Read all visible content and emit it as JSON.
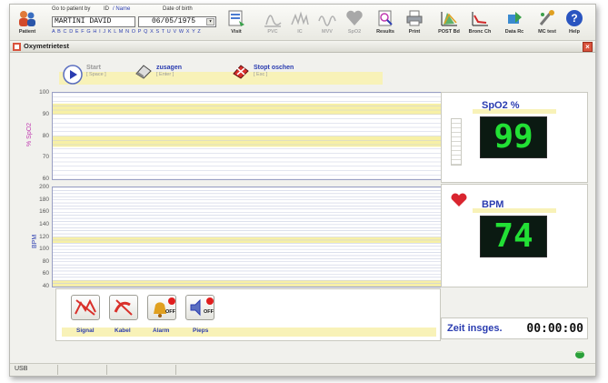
{
  "toolbar": {
    "patient_label": "Patient",
    "goto_label": "Go to patient by",
    "id_label": "ID",
    "slash_name_label": "/ Name",
    "dob_label": "Date of birth",
    "patient_name": "MARTINI DAVID",
    "dob_value": "06/05/1975",
    "alphabet": "A B C D E F G H I J K L M N O P Q X S T U V W X Y Z",
    "buttons": [
      {
        "label": "Visit",
        "enabled": true
      },
      {
        "label": "PVC",
        "enabled": false
      },
      {
        "label": "IC",
        "enabled": false
      },
      {
        "label": "MVV",
        "enabled": false
      },
      {
        "label": "SpO2",
        "enabled": false
      },
      {
        "label": "Results",
        "enabled": true
      },
      {
        "label": "Print",
        "enabled": true
      },
      {
        "label": "POST Bd",
        "enabled": true
      },
      {
        "label": "Bronc Ch",
        "enabled": true
      },
      {
        "label": "Data Rc",
        "enabled": true
      },
      {
        "label": "MC test",
        "enabled": true
      },
      {
        "label": "Help",
        "enabled": true
      }
    ]
  },
  "window": {
    "title": "Oxymetrietest",
    "close": "×"
  },
  "actions": {
    "start": {
      "label": "Start",
      "key": "[ Space ]"
    },
    "zusagen": {
      "label": "zusagen",
      "key": "[ Enter ]"
    },
    "stop": {
      "label": "Stopt oschen",
      "key": "[ Esc ]"
    }
  },
  "spo2_chart": {
    "ylabel": "% SpO2",
    "ticks": [
      "100",
      "90",
      "80",
      "70",
      "60"
    ],
    "ylim": [
      60,
      100
    ],
    "band_color": "#f7f0a6"
  },
  "bpm_chart": {
    "ylabel": "BPM",
    "ticks": [
      "200",
      "180",
      "160",
      "140",
      "120",
      "100",
      "80",
      "60",
      "40"
    ],
    "ylim": [
      40,
      200
    ],
    "band_color": "#f7f0a6"
  },
  "readouts": {
    "spo2_label": "SpO2 %",
    "spo2_value": "99",
    "bpm_label": "BPM",
    "bpm_value": "74",
    "value_color": "#22e035",
    "label_color": "#2a3cb0"
  },
  "sensors": [
    {
      "label": "Signal",
      "state": ""
    },
    {
      "label": "Kabel",
      "state": ""
    },
    {
      "label": "Alarm",
      "state": "OFF"
    },
    {
      "label": "Pieps",
      "state": "OFF"
    }
  ],
  "timer": {
    "label": "Zeit insges.",
    "value": "00:00:00"
  },
  "status": {
    "left": "USB"
  },
  "colors": {
    "accent_blue": "#2a3cb0",
    "spo2_label": "#c03ab0",
    "bpm_label": "#2a3cb0",
    "heart": "#d9252f"
  }
}
